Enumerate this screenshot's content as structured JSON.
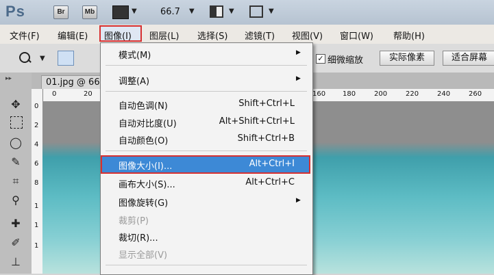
{
  "titlebar": {
    "logo": "Ps",
    "btn_br": "Br",
    "btn_mb": "Mb",
    "zoom": "66.7",
    "caret": "▼"
  },
  "menubar": {
    "file": "文件(F)",
    "edit": "编辑(E)",
    "image": "图像(I)",
    "layer": "图层(L)",
    "select": "选择(S)",
    "filter": "滤镜(T)",
    "view": "视图(V)",
    "window": "窗口(W)",
    "help": "帮助(H)"
  },
  "options": {
    "scrubby_zoom": "细微缩放",
    "actual_pixels": "实际像素",
    "fit_screen": "适合屏幕",
    "checkmark": "✓"
  },
  "document": {
    "tab": "01.jpg @ 66",
    "ruler_ticks": [
      "0",
      "20",
      "160",
      "180",
      "200",
      "220",
      "240",
      "260"
    ],
    "vruler_ticks": [
      "0",
      "2",
      "4",
      "6",
      "8",
      "1",
      "1",
      "1"
    ]
  },
  "image_menu": {
    "mode": "模式(M)",
    "adjustments": "调整(A)",
    "auto_tone": "自动色调(N)",
    "auto_tone_sc": "Shift+Ctrl+L",
    "auto_contrast": "自动对比度(U)",
    "auto_contrast_sc": "Alt+Shift+Ctrl+L",
    "auto_color": "自动颜色(O)",
    "auto_color_sc": "Shift+Ctrl+B",
    "image_size": "图像大小(I)...",
    "image_size_sc": "Alt+Ctrl+I",
    "canvas_size": "画布大小(S)...",
    "canvas_size_sc": "Alt+Ctrl+C",
    "rotation": "图像旋转(G)",
    "crop": "裁剪(P)",
    "trim": "裁切(R)...",
    "reveal_all": "显示全部(V)"
  },
  "colors": {
    "highlight": "#3d89d6",
    "annotation_red": "#d72f2f"
  }
}
